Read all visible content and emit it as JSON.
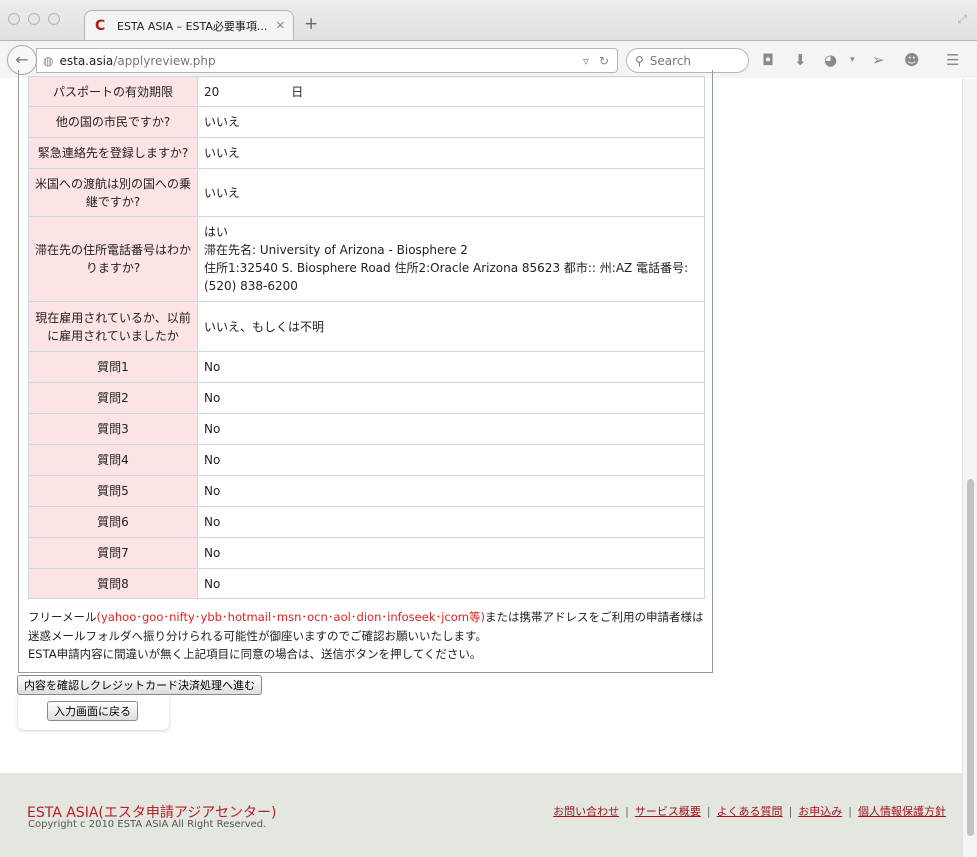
{
  "browser": {
    "tab_title": "ESTA ASIA – ESTA必要事項...",
    "url_host": "esta.asia",
    "url_path": "/applyreview.php",
    "search_placeholder": "Search"
  },
  "rows": [
    {
      "label": "パスポートの有効期限",
      "lines": [
        "20　　　　　　日"
      ]
    },
    {
      "label": "他の国の市民ですか?",
      "lines": [
        "いいえ"
      ]
    },
    {
      "label": "緊急連絡先を登録しますか?",
      "lines": [
        "いいえ"
      ]
    },
    {
      "label": "米国への渡航は別の国への乗継ですか?",
      "lines": [
        "いいえ"
      ]
    },
    {
      "label": "滞在先の住所電話番号はわかりますか?",
      "lines": [
        "はい",
        "滞在先名: University of Arizona - Biosphere 2",
        "住所1:32540 S. Biosphere Road 住所2:Oracle Arizona 85623 都市:: 州:AZ 電話番号:",
        "(520) 838-6200"
      ]
    },
    {
      "label": "現在雇用されているか、以前に雇用されていましたか",
      "lines": [
        "いいえ、もしくは不明"
      ]
    },
    {
      "label": "質問1",
      "lines": [
        "No"
      ]
    },
    {
      "label": "質問2",
      "lines": [
        "No"
      ]
    },
    {
      "label": "質問3",
      "lines": [
        "No"
      ]
    },
    {
      "label": "質問4",
      "lines": [
        "No"
      ]
    },
    {
      "label": "質問5",
      "lines": [
        "No"
      ]
    },
    {
      "label": "質問6",
      "lines": [
        "No"
      ]
    },
    {
      "label": "質問7",
      "lines": [
        "No"
      ]
    },
    {
      "label": "質問8",
      "lines": [
        "No"
      ]
    }
  ],
  "note": {
    "prefix": "フリーメール",
    "providers": "(yahoo･goo･nifty･ybb･hotmail･msn･ocn･aol･dion･infoseek･jcom等)",
    "suffix": "または携帯アドレスをご利用の申請者様は",
    "line2": "迷惑メールフォルダへ振り分けられる可能性が御座いますのでご確認お願いいたします。",
    "line3": "ESTA申請内容に間違いが無く上記項目に同意の場合は、送信ボタンを押してください。"
  },
  "buttons": {
    "proceed": "内容を確認しクレジットカード決済処理へ進む",
    "back": "入力画面に戻る"
  },
  "footer": {
    "brand": "ESTA ASIA(エスタ申請アジアセンター)",
    "copyright": "Copyright c 2010 ESTA ASIA All Right Reserved.",
    "links": [
      "お問い合わせ",
      "サービス概要",
      "よくある質問",
      "お申込み",
      "個人情報保護方針"
    ]
  },
  "colors": {
    "label_bg": "#fde3e3",
    "brand_red": "#b81f26",
    "note_red": "#e52020",
    "footer_bg": "#e4e6e0"
  }
}
